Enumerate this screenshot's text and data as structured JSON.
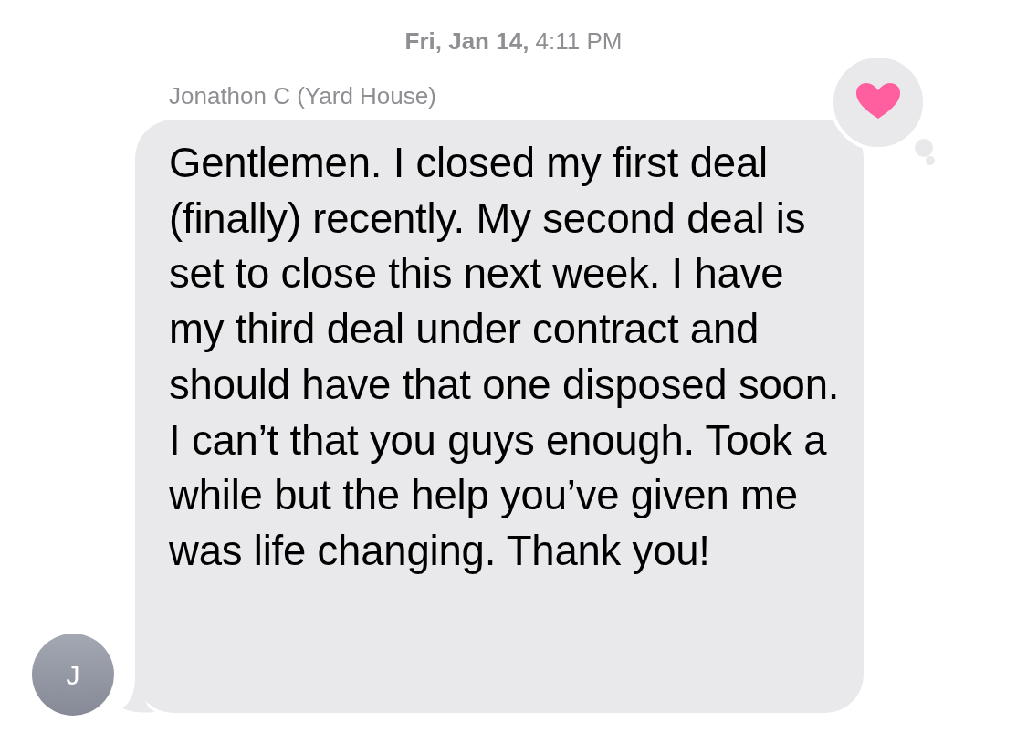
{
  "timestamp": "**Fri, Jan 14,** 4:11 PM",
  "message": {
    "sender": "Jonathon C (Yard House)",
    "avatar_initial": "J",
    "reaction": {
      "kind": "heart",
      "color": "#ff5f9e"
    },
    "text": "Gentlemen. I closed my first deal (finally) recently. My second deal is set to close this next week. I have my third deal under contract and should have that one disposed soon. I can’t that you guys enough. Took a while but the help you’ve given me was life changing. Thank you!"
  }
}
